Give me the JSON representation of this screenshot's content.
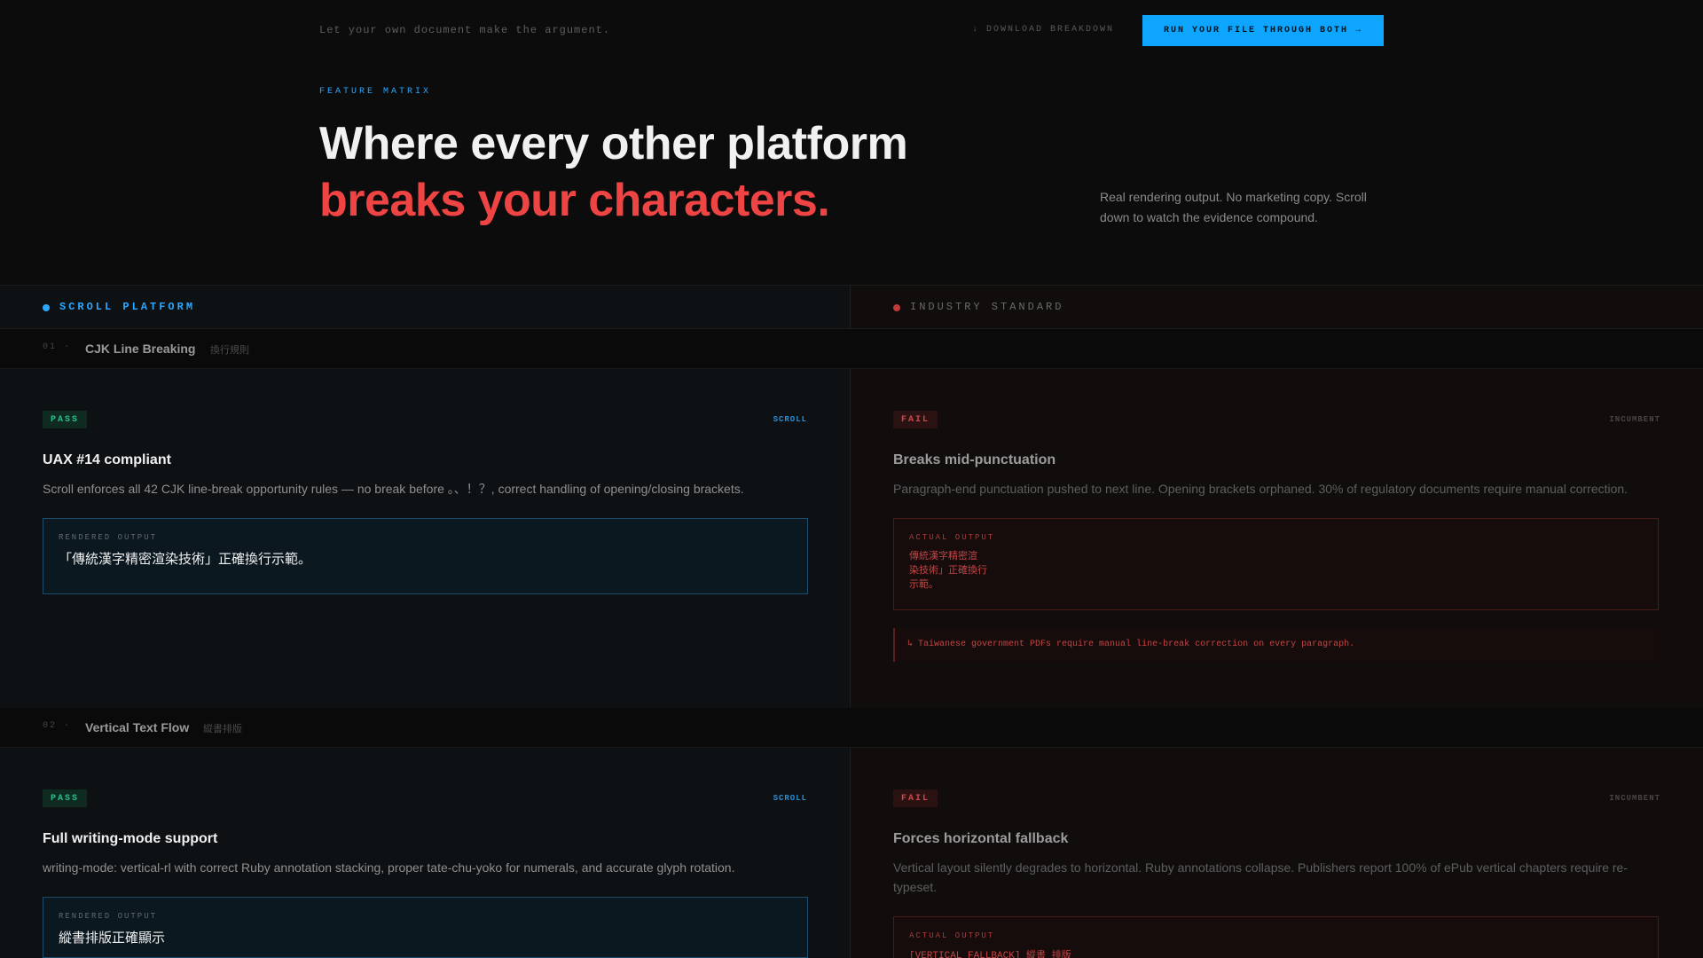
{
  "header": {
    "tagline": "Let your own document make the argument.",
    "download_label": "↓ DOWNLOAD BREAKDOWN",
    "cta_label": "RUN YOUR FILE THROUGH BOTH →"
  },
  "hero": {
    "eyebrow": "FEATURE MATRIX",
    "title_line1": "Where every other platform",
    "title_line2": "breaks your characters.",
    "description": "Real rendering output. No marketing copy. Scroll down to watch the evidence compound."
  },
  "columns": {
    "left": {
      "label": "SCROLL PLATFORM",
      "color": "#2aa7ff"
    },
    "right": {
      "label": "INDUSTRY STANDARD",
      "color": "#c03a3a"
    }
  },
  "sections": [
    {
      "num": "01 ·",
      "title": "CJK Line Breaking",
      "subtitle": "換行規則",
      "left": {
        "badge": "PASS",
        "tag": "SCROLL",
        "title": "UAX #14 compliant",
        "description": "Scroll enforces all 42 CJK line-break opportunity rules — no break before 。、！？, correct handling of opening/closing brackets.",
        "output_label": "RENDERED OUTPUT",
        "output_text": "「傳統漢字精密渲染技術」正確換行示範。"
      },
      "right": {
        "badge": "FAIL",
        "tag": "INCUMBENT",
        "title": "Breaks mid-punctuation",
        "description": "Paragraph-end punctuation pushed to next line. Opening brackets orphaned. 30% of regulatory documents require manual correction.",
        "output_label": "ACTUAL OUTPUT",
        "output_lines": [
          "傳統漢字精密渲",
          "染技術」正確換行",
          "示範。"
        ],
        "note": "↳ Taiwanese government PDFs require manual line-break correction on every paragraph."
      }
    },
    {
      "num": "02 ·",
      "title": "Vertical Text Flow",
      "subtitle": "縱書排版",
      "left": {
        "badge": "PASS",
        "tag": "SCROLL",
        "title": "Full writing-mode support",
        "description": "writing-mode: vertical-rl with correct Ruby annotation stacking, proper tate-chu-yoko for numerals, and accurate glyph rotation.",
        "output_label": "RENDERED OUTPUT",
        "output_text": "縱書排版正確顯示"
      },
      "right": {
        "badge": "FAIL",
        "tag": "INCUMBENT",
        "title": "Forces horizontal fallback",
        "description": "Vertical layout silently degrades to horizontal. Ruby annotations collapse. Publishers report 100% of ePub vertical chapters require re-typeset.",
        "output_label": "ACTUAL OUTPUT",
        "output_text": "[VERTICAL FALLBACK] 縱書 排版"
      }
    }
  ]
}
